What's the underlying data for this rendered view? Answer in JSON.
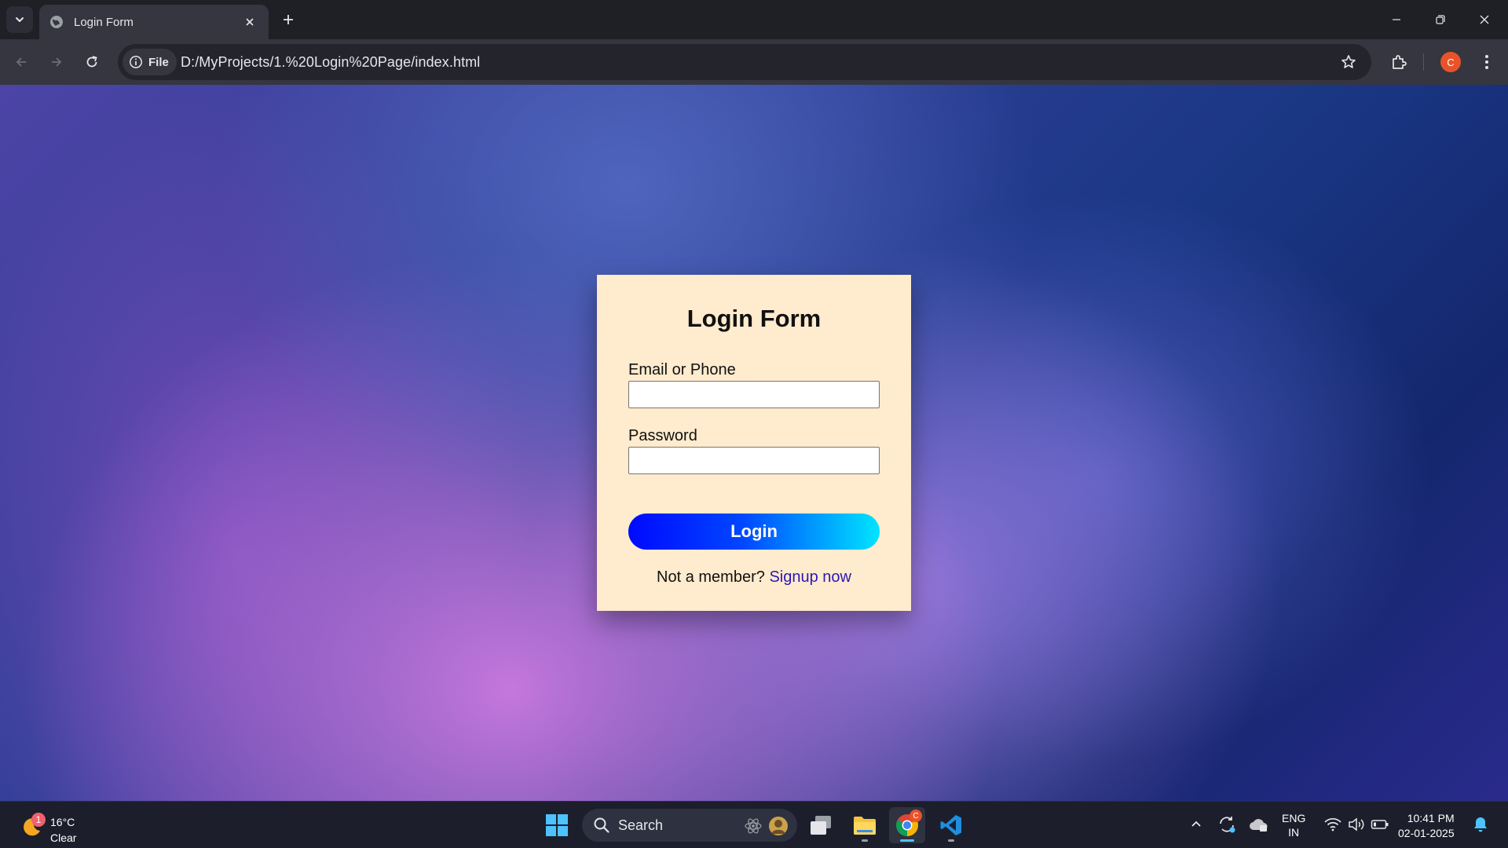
{
  "browser": {
    "tab_title": "Login Form",
    "url": "D:/MyProjects/1.%20Login%20Page/index.html",
    "site_info_label": "File",
    "profile_initial": "C"
  },
  "form": {
    "title": "Login Form",
    "email_label": "Email or Phone",
    "email_value": "",
    "password_label": "Password",
    "password_value": "",
    "login_label": "Login",
    "signup_prompt": "Not a member?",
    "signup_link": "Signup now"
  },
  "taskbar": {
    "weather_temp": "16°C",
    "weather_condition": "Clear",
    "weather_badge": "1",
    "search_label": "Search",
    "chrome_badge": "C",
    "lang_line1": "ENG",
    "lang_line2": "IN",
    "time": "10:41 PM",
    "date": "02-01-2025"
  },
  "colors": {
    "card_bg": "#ffebcd",
    "login_gradient_start": "#0009ff",
    "login_gradient_end": "#00e4ff",
    "signup_link": "#2b18b8",
    "profile_avatar": "#e8532a"
  }
}
